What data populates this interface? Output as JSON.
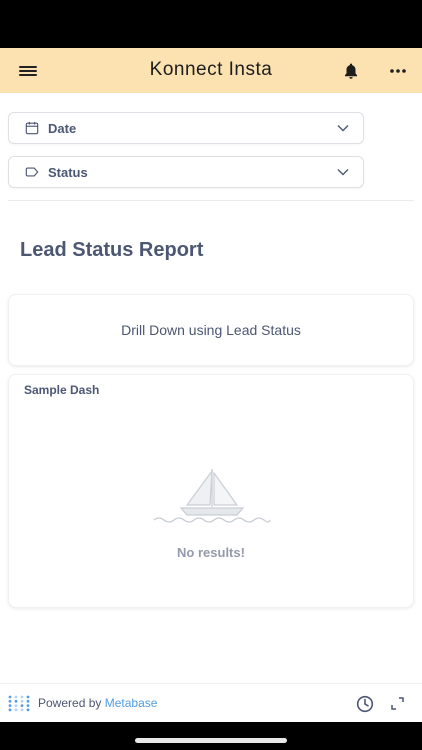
{
  "header": {
    "title": "Konnect Insta",
    "menu_icon": "hamburger-menu-icon",
    "notification_icon": "bell-icon",
    "more_icon": "more-horizontal-icon"
  },
  "filters": [
    {
      "label": "Date",
      "icon": "calendar-icon"
    },
    {
      "label": "Status",
      "icon": "tag-icon"
    }
  ],
  "report": {
    "title": "Lead Status Report"
  },
  "cards": {
    "text_card": {
      "text": "Drill Down using Lead Status"
    },
    "dash_card": {
      "title": "Sample Dash",
      "empty_text": "No results!"
    }
  },
  "footer": {
    "powered_prefix": "Powered by",
    "brand": "Metabase",
    "brand_color": "#509ee3"
  },
  "colors": {
    "header_bg": "#fbe2b0",
    "text_primary": "#4c5773",
    "text_muted": "#949aab"
  }
}
